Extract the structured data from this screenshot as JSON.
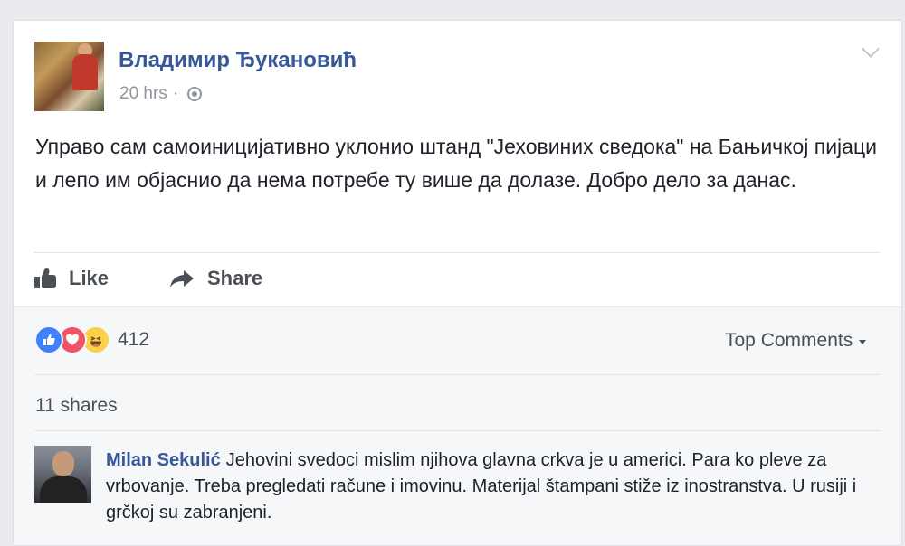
{
  "post": {
    "author": "Владимир Ђукановић",
    "time": "20 hrs",
    "separator": "·",
    "privacy_icon": "globe-icon",
    "text": "Управо сам самоиницијативно уклонио штанд \"Јеховиних сведока\" на Бањичкој пијаци и лепо им објаснио да нема потребе ту више да долазе. Добро дело за данас.",
    "menu_icon": "chevron-down-icon"
  },
  "actions": {
    "like_label": "Like",
    "share_label": "Share"
  },
  "reactions": {
    "icons": [
      "like-reaction-icon",
      "love-reaction-icon",
      "haha-reaction-icon"
    ],
    "count": "412",
    "colors": {
      "like": "#4080ff",
      "love": "#f25268",
      "haha": "#fcd147"
    }
  },
  "comments_filter": {
    "label": "Top Comments"
  },
  "shares": {
    "label": "11 shares"
  },
  "comment": {
    "author": "Milan Sekulić",
    "text": "Jehovini svedoci mislim njihova glavna crkva je u americi. Para ko pleve za vrbovanje. Treba pregledati račune i imovinu. Materijal štampani stiže iz inostranstva. U rusiji i grčkoj su zabranjeni."
  },
  "theme": {
    "link": "#365899",
    "muted": "#90949c",
    "background": "#e9ebee"
  }
}
